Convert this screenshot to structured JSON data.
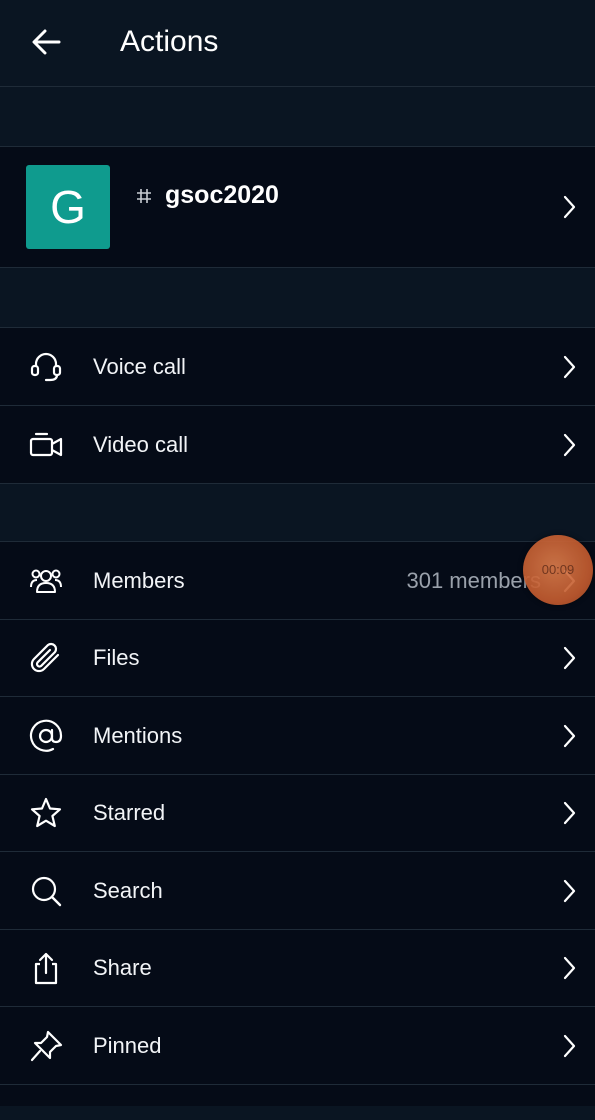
{
  "header": {
    "title": "Actions",
    "back_icon": "arrow-left-icon"
  },
  "channel": {
    "avatar_letter": "G",
    "avatar_color": "#0f9b8e",
    "name": "gsoc2020"
  },
  "call_actions": [
    {
      "label": "Voice call",
      "icon": "headset-icon"
    },
    {
      "label": "Video call",
      "icon": "video-camera-icon"
    }
  ],
  "room_actions": [
    {
      "label": "Members",
      "value": "301 members",
      "icon": "members-icon"
    },
    {
      "label": "Files",
      "icon": "paperclip-icon"
    },
    {
      "label": "Mentions",
      "icon": "at-sign-icon"
    },
    {
      "label": "Starred",
      "icon": "star-icon"
    },
    {
      "label": "Search",
      "icon": "search-icon"
    },
    {
      "label": "Share",
      "icon": "share-icon"
    },
    {
      "label": "Pinned",
      "icon": "pin-icon"
    }
  ],
  "recorder": {
    "time": "00:09"
  },
  "colors": {
    "background": "#050b17",
    "header": "#0a1522",
    "divider": "#1f2b38",
    "muted_text": "#9aa1ab"
  }
}
